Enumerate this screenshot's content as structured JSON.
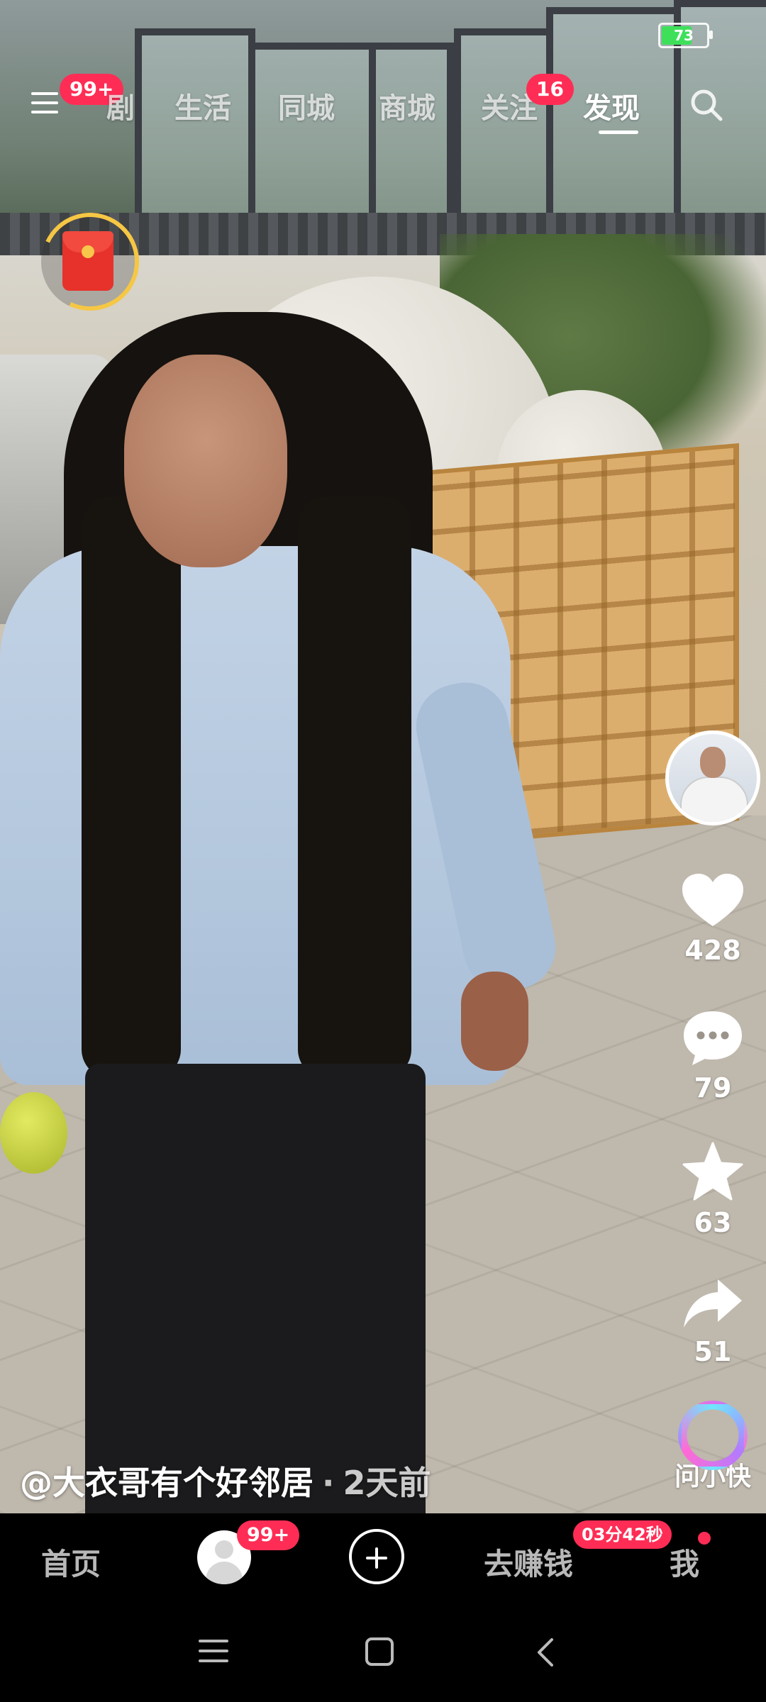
{
  "status_bar": {
    "battery_level": "73"
  },
  "top_tabs": {
    "items": [
      {
        "id": "drama",
        "label": "剧"
      },
      {
        "id": "life",
        "label": "生活"
      },
      {
        "id": "local",
        "label": "同城"
      },
      {
        "id": "mall",
        "label": "商城"
      },
      {
        "id": "follow",
        "label": "关注"
      },
      {
        "id": "discover",
        "label": "发现"
      }
    ],
    "active": "discover",
    "menu_badge": "99+",
    "follow_badge": "16"
  },
  "video": {
    "author": "@大衣哥有个好邻居",
    "separator": "·",
    "posted": "2天前"
  },
  "actions": {
    "likes": "428",
    "comments": "79",
    "favorites": "63",
    "shares": "51",
    "ai_assistant": "问小快"
  },
  "bottom_nav": {
    "home": "首页",
    "friends_badge": "99+",
    "earn": "去赚钱",
    "earn_badge": "03分42秒",
    "me": "我"
  },
  "colors": {
    "badge": "#ff2d55",
    "battery": "#3ee05a",
    "red_packet": "#e6322b"
  }
}
